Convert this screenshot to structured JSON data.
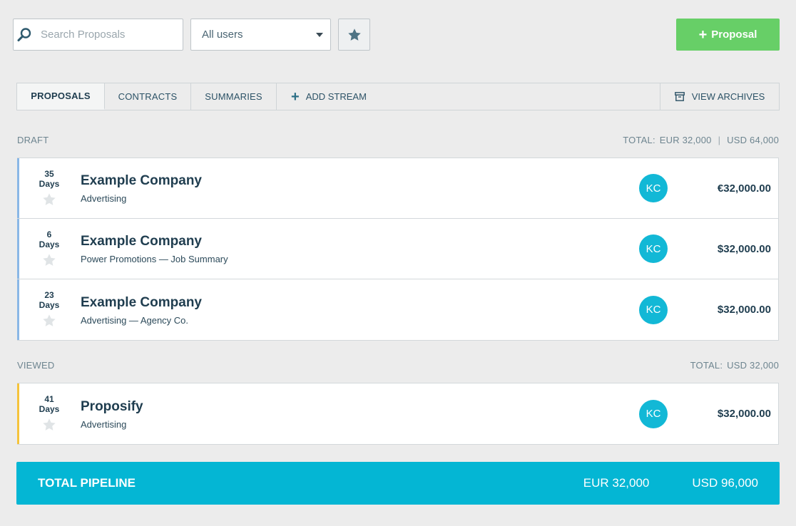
{
  "toolbar": {
    "search_placeholder": "Search Proposals",
    "user_filter": "All users",
    "new_proposal_label": "Proposal"
  },
  "tabs": {
    "items": [
      {
        "label": "PROPOSALS",
        "active": true
      },
      {
        "label": "CONTRACTS",
        "active": false
      },
      {
        "label": "SUMMARIES",
        "active": false
      }
    ],
    "add_stream": "ADD STREAM",
    "view_archives": "VIEW ARCHIVES"
  },
  "sections": {
    "draft": {
      "title": "DRAFT",
      "total_label": "TOTAL:",
      "total_eur": "EUR 32,000",
      "total_usd": "USD 64,000",
      "bar_color": "#8ab7e6",
      "rows": [
        {
          "days": "35",
          "days_label": "Days",
          "title": "Example Company",
          "subtitle": "Advertising",
          "avatar": "KC",
          "amount": "€32,000.00"
        },
        {
          "days": "6",
          "days_label": "Days",
          "title": "Example Company",
          "subtitle": "Power Promotions — Job Summary",
          "avatar": "KC",
          "amount": "$32,000.00"
        },
        {
          "days": "23",
          "days_label": "Days",
          "title": "Example Company",
          "subtitle": "Advertising — Agency Co.",
          "avatar": "KC",
          "amount": "$32,000.00"
        }
      ]
    },
    "viewed": {
      "title": "VIEWED",
      "total_label": "TOTAL:",
      "total_usd": "USD 32,000",
      "bar_color": "#f5c33b",
      "rows": [
        {
          "days": "41",
          "days_label": "Days",
          "title": "Proposify",
          "subtitle": "Advertising",
          "avatar": "KC",
          "amount": "$32,000.00"
        }
      ]
    }
  },
  "pipeline": {
    "label": "TOTAL PIPELINE",
    "eur": "EUR 32,000",
    "usd": "USD 96,000"
  },
  "colors": {
    "accent": "#04b6d4",
    "primary_button": "#67cf67",
    "avatar": "#12b8d6"
  }
}
